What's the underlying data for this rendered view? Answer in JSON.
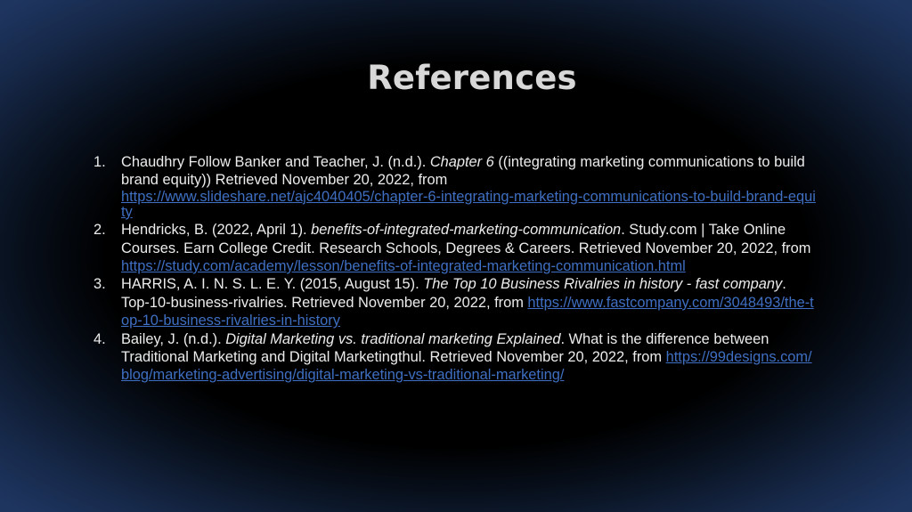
{
  "slide": {
    "title": "References"
  },
  "references": [
    {
      "number": "1.",
      "pre": "Chaudhry Follow Banker and Teacher, J. (n.d.). ",
      "italic": "Chapter 6",
      "post": " ((integrating marketing communications to build brand equity)) Retrieved November 20, 2022, from ",
      "url": "https://www.slideshare.net/ajc4040405/chapter-6-integrating-marketing-communications-to-build-brand-equity"
    },
    {
      "number": "2.",
      "pre": "Hendricks, B. (2022, April 1). ",
      "italic": "benefits-of-integrated-marketing-communication",
      "post": ". Study.com | Take Online Courses. Earn College Credit. Research Schools, Degrees & Careers. Retrieved November 20, 2022, from ",
      "url": "https://study.com/academy/lesson/benefits-of-integrated-marketing-communication.html"
    },
    {
      "number": "3.",
      "pre": "HARRIS, A. I. N. S. L. E. Y. (2015, August 15). ",
      "italic": "The Top 10 Business Rivalries in history - fast company",
      "post": ". Top-10-business-rivalries. Retrieved November 20, 2022, from ",
      "url": "https://www.fastcompany.com/3048493/the-top-10-business-rivalries-in-history"
    },
    {
      "number": "4.",
      "pre": "Bailey, J. (n.d.). ",
      "italic": "Digital Marketing vs. traditional marketing Explained",
      "post": ". What is the difference between Traditional Marketing and Digital Marketingthul. Retrieved November 20, 2022, from ",
      "url": "https://99designs.com/blog/marketing-advertising/digital-marketing-vs-traditional-marketing/"
    }
  ]
}
